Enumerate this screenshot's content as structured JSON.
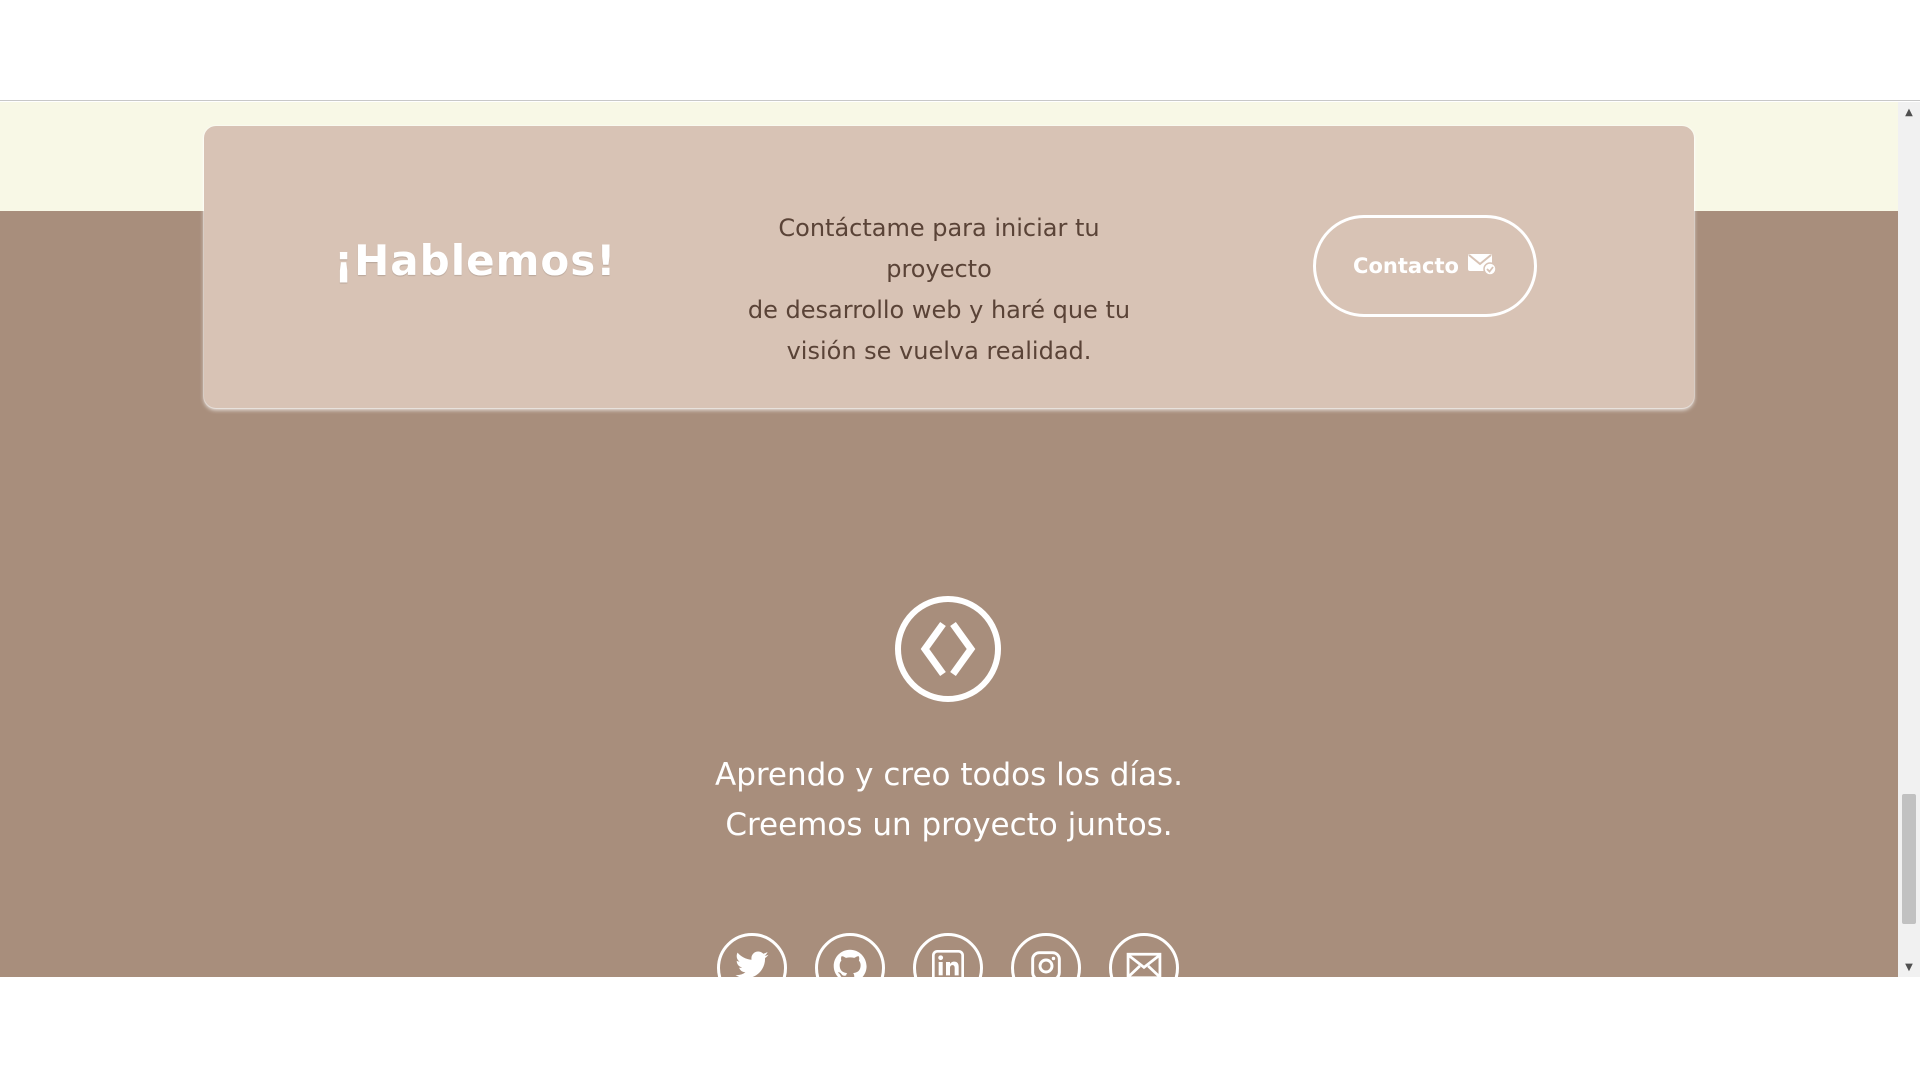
{
  "cta": {
    "title": "¡Hablemos!",
    "line1": "Contáctame para iniciar tu proyecto",
    "line2": "de desarrollo web y haré que tu",
    "line3": "visión se vuelva realidad.",
    "button_label": "Contacto",
    "button_icon": "mail-icon"
  },
  "footer": {
    "logo_icon": "code-brackets-icon",
    "tagline_line1": "Aprendo y creo todos los días.",
    "tagline_line2": "Creemos un proyecto juntos.",
    "social": [
      {
        "icon": "twitter-icon"
      },
      {
        "icon": "github-icon"
      },
      {
        "icon": "linkedin-icon"
      },
      {
        "icon": "instagram-icon"
      },
      {
        "icon": "email-icon"
      }
    ]
  },
  "colors": {
    "cream_band": "#f8f8e6",
    "footer_background": "#a88e7c",
    "card_background": "#d8c3b5",
    "card_text": "#5a4337",
    "white": "#ffffff"
  }
}
